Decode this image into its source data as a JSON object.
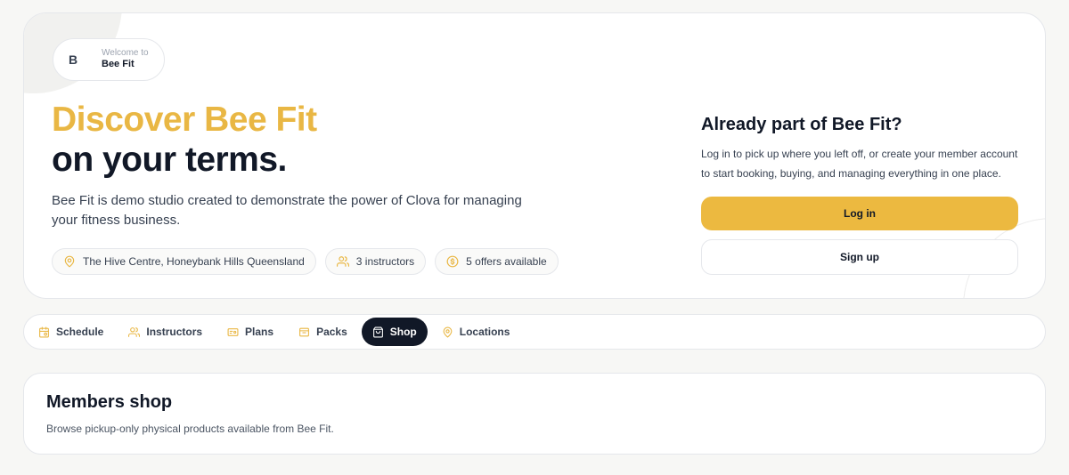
{
  "hero": {
    "welcome_avatar": "B",
    "welcome_small": "Welcome to",
    "welcome_name": "Bee Fit",
    "headline_accent": "Discover Bee Fit",
    "headline_main": "on your terms.",
    "description": "Bee Fit is demo studio created to demonstrate the power of Clova for managing your fitness business.",
    "chips": [
      {
        "icon": "location-pin-icon",
        "label": "The Hive Centre, Honeybank Hills Queensland"
      },
      {
        "icon": "users-icon",
        "label": "3 instructors"
      },
      {
        "icon": "dollar-coin-icon",
        "label": "5 offers available"
      }
    ]
  },
  "account": {
    "title": "Already part of Bee Fit?",
    "description": "Log in to pick up where you left off, or create your member account to start booking, buying, and managing everything in one place.",
    "login_label": "Log in",
    "signup_label": "Sign up"
  },
  "tabs": [
    {
      "icon": "calendar-icon",
      "label": "Schedule",
      "active": false
    },
    {
      "icon": "users-icon",
      "label": "Instructors",
      "active": false
    },
    {
      "icon": "id-card-icon",
      "label": "Plans",
      "active": false
    },
    {
      "icon": "package-icon",
      "label": "Packs",
      "active": false
    },
    {
      "icon": "shopping-bag-icon",
      "label": "Shop",
      "active": true
    },
    {
      "icon": "location-pin-icon",
      "label": "Locations",
      "active": false
    }
  ],
  "shop": {
    "title": "Members shop",
    "description": "Browse pickup-only physical products available from Bee Fit."
  },
  "colors": {
    "accent": "#e9b744",
    "button_primary": "#ecb940",
    "dark": "#111827"
  }
}
